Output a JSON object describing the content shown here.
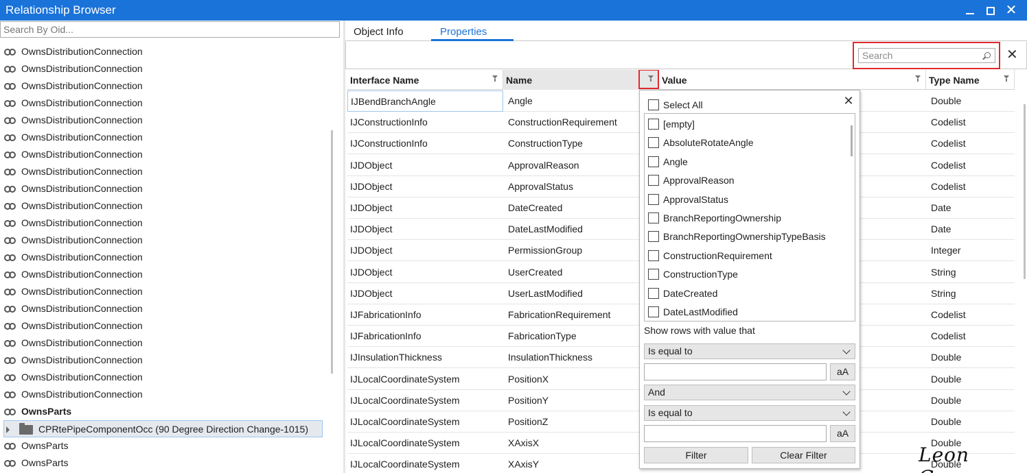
{
  "window": {
    "title": "Relationship Browser"
  },
  "left": {
    "search_placeholder": "Search By Oid...",
    "items": [
      {
        "label": "OwnsDistributionConnection"
      },
      {
        "label": "OwnsDistributionConnection"
      },
      {
        "label": "OwnsDistributionConnection"
      },
      {
        "label": "OwnsDistributionConnection"
      },
      {
        "label": "OwnsDistributionConnection"
      },
      {
        "label": "OwnsDistributionConnection"
      },
      {
        "label": "OwnsDistributionConnection"
      },
      {
        "label": "OwnsDistributionConnection"
      },
      {
        "label": "OwnsDistributionConnection"
      },
      {
        "label": "OwnsDistributionConnection"
      },
      {
        "label": "OwnsDistributionConnection"
      },
      {
        "label": "OwnsDistributionConnection"
      },
      {
        "label": "OwnsDistributionConnection"
      },
      {
        "label": "OwnsDistributionConnection"
      },
      {
        "label": "OwnsDistributionConnection"
      },
      {
        "label": "OwnsDistributionConnection"
      },
      {
        "label": "OwnsDistributionConnection"
      },
      {
        "label": "OwnsDistributionConnection"
      },
      {
        "label": "OwnsDistributionConnection"
      },
      {
        "label": "OwnsDistributionConnection"
      },
      {
        "label": "OwnsDistributionConnection"
      },
      {
        "label": "OwnsParts"
      },
      {
        "label": "CPRtePipeComponentOcc (90 Degree Direction Change-1015)"
      },
      {
        "label": "OwnsParts"
      },
      {
        "label": "OwnsParts"
      }
    ]
  },
  "tabs": [
    {
      "label": "Object Info"
    },
    {
      "label": "Properties"
    }
  ],
  "toolbar": {
    "search_placeholder": "Search"
  },
  "grid": {
    "headers": [
      "Interface Name",
      "Name",
      "Value",
      "Type Name"
    ],
    "rows": [
      {
        "iface": "IJBendBranchAngle",
        "name": "Angle",
        "value": "",
        "type": "Double"
      },
      {
        "iface": "IJConstructionInfo",
        "name": "ConstructionRequirement",
        "value": "",
        "type": "Codelist"
      },
      {
        "iface": "IJConstructionInfo",
        "name": "ConstructionType",
        "value": "",
        "type": "Codelist"
      },
      {
        "iface": "IJDObject",
        "name": "ApprovalReason",
        "value": "",
        "type": "Codelist"
      },
      {
        "iface": "IJDObject",
        "name": "ApprovalStatus",
        "value": "",
        "type": "Codelist"
      },
      {
        "iface": "IJDObject",
        "name": "DateCreated",
        "value": "",
        "type": "Date"
      },
      {
        "iface": "IJDObject",
        "name": "DateLastModified",
        "value": "",
        "type": "Date"
      },
      {
        "iface": "IJDObject",
        "name": "PermissionGroup",
        "value": "",
        "type": "Integer"
      },
      {
        "iface": "IJDObject",
        "name": "UserCreated",
        "value": "",
        "type": "String"
      },
      {
        "iface": "IJDObject",
        "name": "UserLastModified",
        "value": "",
        "type": "String"
      },
      {
        "iface": "IJFabricationInfo",
        "name": "FabricationRequirement",
        "value": "",
        "type": "Codelist"
      },
      {
        "iface": "IJFabricationInfo",
        "name": "FabricationType",
        "value": "",
        "type": "Codelist"
      },
      {
        "iface": "IJInsulationThickness",
        "name": "InsulationThickness",
        "value": "",
        "type": "Double"
      },
      {
        "iface": "IJLocalCoordinateSystem",
        "name": "PositionX",
        "value": "",
        "type": "Double"
      },
      {
        "iface": "IJLocalCoordinateSystem",
        "name": "PositionY",
        "value": "",
        "type": "Double"
      },
      {
        "iface": "IJLocalCoordinateSystem",
        "name": "PositionZ",
        "value": "",
        "type": "Double"
      },
      {
        "iface": "IJLocalCoordinateSystem",
        "name": "XAxisX",
        "value": "",
        "type": "Double"
      },
      {
        "iface": "IJLocalCoordinateSystem",
        "name": "XAxisY",
        "value": "",
        "type": "Double"
      }
    ]
  },
  "filter_popup": {
    "select_all": "Select All",
    "options": [
      "[empty]",
      "AbsoluteRotateAngle",
      "Angle",
      "ApprovalReason",
      "ApprovalStatus",
      "BranchReportingOwnership",
      "BranchReportingOwnershipTypeBasis",
      "ConstructionRequirement",
      "ConstructionType",
      "DateCreated",
      "DateLastModified"
    ],
    "show_rows_label": "Show rows with value that",
    "operator1": "Is equal to",
    "logic": "And",
    "operator2": "Is equal to",
    "case_button": "aA",
    "filter_button": "Filter",
    "clear_button": "Clear Filter"
  },
  "signature": "Leon Geng",
  "colors": {
    "accent": "#1a73d9",
    "highlight": "#e0282e"
  }
}
